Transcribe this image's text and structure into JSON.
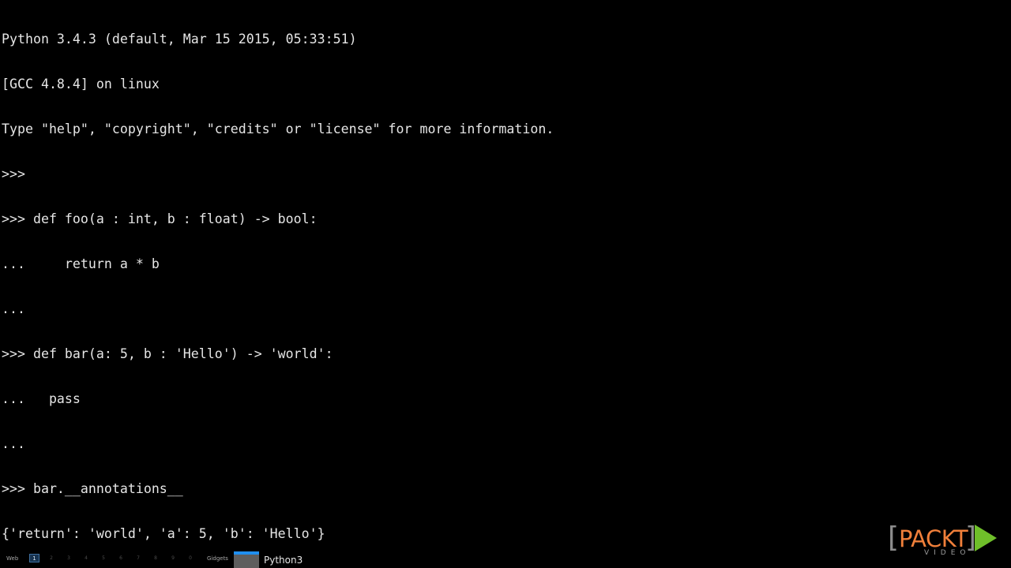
{
  "terminal": {
    "lines": [
      "Python 3.4.3 (default, Mar 15 2015, 05:33:51)",
      "[GCC 4.8.4] on linux",
      "Type \"help\", \"copyright\", \"credits\" or \"license\" for more information.",
      ">>>",
      ">>> def foo(a : int, b : float) -> bool:",
      "...     return a * b",
      "...",
      ">>> def bar(a: 5, b : 'Hello') -> 'world':",
      "...   pass",
      "...",
      ">>> bar.__annotations__",
      "{'return': 'world', 'a': 5, 'b': 'Hello'}"
    ],
    "prompt": ">>> "
  },
  "taskbar": {
    "menu_label": "Web",
    "workspaces": [
      "1",
      "2",
      "3",
      "4",
      "5",
      "6",
      "7",
      "8",
      "9",
      "0"
    ],
    "active_workspace": "1",
    "gadgets_label": "Gidgets",
    "task_label": "Python3",
    "task_indicator_color": "#1f8ff0"
  },
  "logo": {
    "left_bracket": "[",
    "word": "PACKT",
    "right_bracket": "]",
    "subtitle": "VIDEO",
    "icon": "play-icon",
    "word_color": "#f07f3a",
    "play_color": "#6fbf2a"
  }
}
